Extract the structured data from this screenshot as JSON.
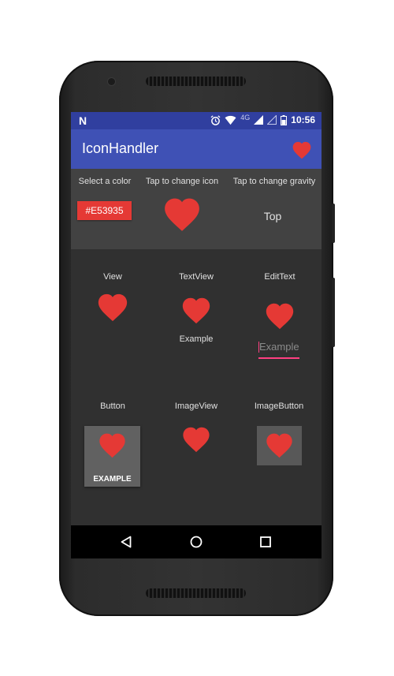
{
  "colors": {
    "accent": "#E53935",
    "appbar": "#3F51B5",
    "statusbar": "#303F9F",
    "edittext_underline": "#FF4081"
  },
  "statusbar": {
    "notification_icon": "N",
    "network": "4G",
    "time": "10:56",
    "icons": [
      "alarm-icon",
      "wifi-icon",
      "signal-icon",
      "signal-empty-icon",
      "battery-icon"
    ]
  },
  "appbar": {
    "title": "IconHandler",
    "action_icon": "heart-icon"
  },
  "settings": {
    "color_label": "Select a color",
    "color_value": "#E53935",
    "icon_label": "Tap to change icon",
    "gravity_label": "Tap to change gravity",
    "gravity_value": "Top"
  },
  "demos": {
    "view_label": "View",
    "textview_label": "TextView",
    "textview_text": "Example",
    "edittext_label": "EditText",
    "edittext_placeholder": "Example",
    "button_label": "Button",
    "button_text": "EXAMPLE",
    "imageview_label": "ImageView",
    "imagebutton_label": "ImageButton"
  },
  "navbar": {
    "icons": [
      "back-icon",
      "home-icon",
      "recents-icon"
    ]
  }
}
